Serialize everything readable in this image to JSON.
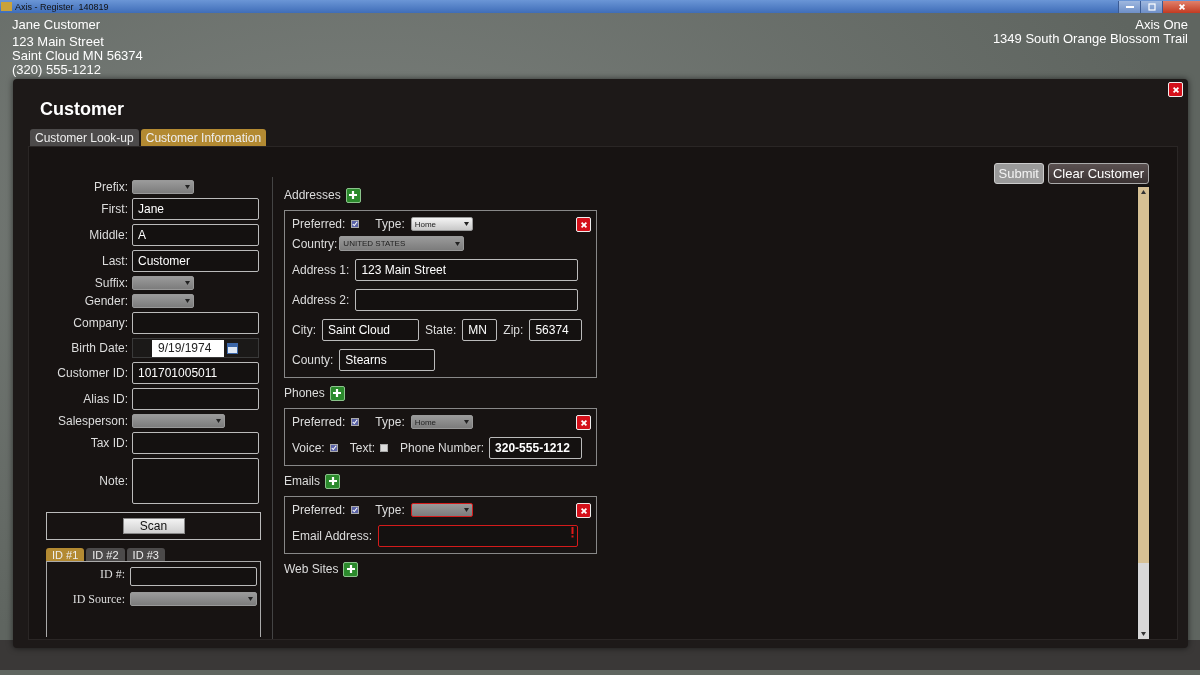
{
  "window": {
    "title": "Axis - Register  140819"
  },
  "customer_header": {
    "lines": [
      "Jane Customer",
      "123 Main Street",
      "Saint Cloud MN 56374",
      "(320) 555-1212"
    ]
  },
  "store_header": {
    "lines": [
      "Axis One",
      "1349 South Orange Blossom Trail"
    ]
  },
  "dialog": {
    "title": "Customer",
    "tabs": [
      {
        "label": "Customer Look-up",
        "selected": false
      },
      {
        "label": "Customer Information",
        "selected": true
      }
    ],
    "buttons": [
      {
        "label": "Submit",
        "disabled": true
      },
      {
        "label": "Clear Customer",
        "disabled": false
      }
    ],
    "fields": [
      {
        "label": "Prefix:",
        "kind": "dropdown"
      },
      {
        "label": "First:",
        "kind": "text",
        "value": "Jane"
      },
      {
        "label": "Middle:",
        "kind": "text",
        "value": "A"
      },
      {
        "label": "Last:",
        "kind": "text",
        "value": "Customer"
      },
      {
        "label": "Suffix:",
        "kind": "dropdown"
      },
      {
        "label": "Gender:",
        "kind": "dropdown"
      },
      {
        "label": "Company:",
        "kind": "text"
      },
      {
        "label": "Birth Date:",
        "kind": "date",
        "value": "9/19/1974"
      },
      {
        "label": "Customer ID:",
        "kind": "text",
        "value": "101701005011"
      },
      {
        "label": "Alias ID:",
        "kind": "text"
      },
      {
        "label": "Salesperson:",
        "kind": "wide-dropdown"
      },
      {
        "label": "Tax ID:",
        "kind": "text"
      },
      {
        "label": "Note:",
        "kind": "textarea"
      }
    ],
    "scan_button": "Scan",
    "id_tabs": [
      {
        "label": "ID #1",
        "selected": true
      },
      {
        "label": "ID #2",
        "selected": false
      },
      {
        "label": "ID #3",
        "selected": false
      }
    ],
    "id_fields": [
      {
        "label": "ID #:",
        "kind": "text"
      },
      {
        "label": "ID Source:",
        "kind": "dropdown"
      }
    ],
    "addresses": {
      "heading": "Addresses",
      "items": [
        {
          "preferred_label": "Preferred:",
          "preferred": true,
          "type_label": "Type:",
          "type": "Home",
          "country_label": "Country:",
          "country": "UNITED STATES",
          "address_1_label": "Address 1:",
          "address_1": "123 Main Street",
          "address_2_label": "Address 2:",
          "city_label": "City:",
          "city": "Saint Cloud",
          "state_label": "State:",
          "state": "MN",
          "zip_label": "Zip:",
          "zip": "56374",
          "county_label": "County:",
          "county": "Stearns"
        }
      ]
    },
    "phones": {
      "heading": "Phones",
      "items": [
        {
          "preferred_label": "Preferred:",
          "preferred": true,
          "type_label": "Type:",
          "type": "Home",
          "voice_label": "Voice:",
          "voice": true,
          "text_label": "Text:",
          "text": false,
          "number_label": "Phone Number:",
          "number": "320-555-1212"
        }
      ]
    },
    "emails": {
      "heading": "Emails",
      "items": [
        {
          "preferred_label": "Preferred:",
          "preferred": true,
          "type_label": "Type:",
          "type_invalid": true,
          "address_label": "Email Address:",
          "address_invalid": true
        }
      ]
    },
    "web_sites": {
      "heading": "Web Sites"
    }
  }
}
